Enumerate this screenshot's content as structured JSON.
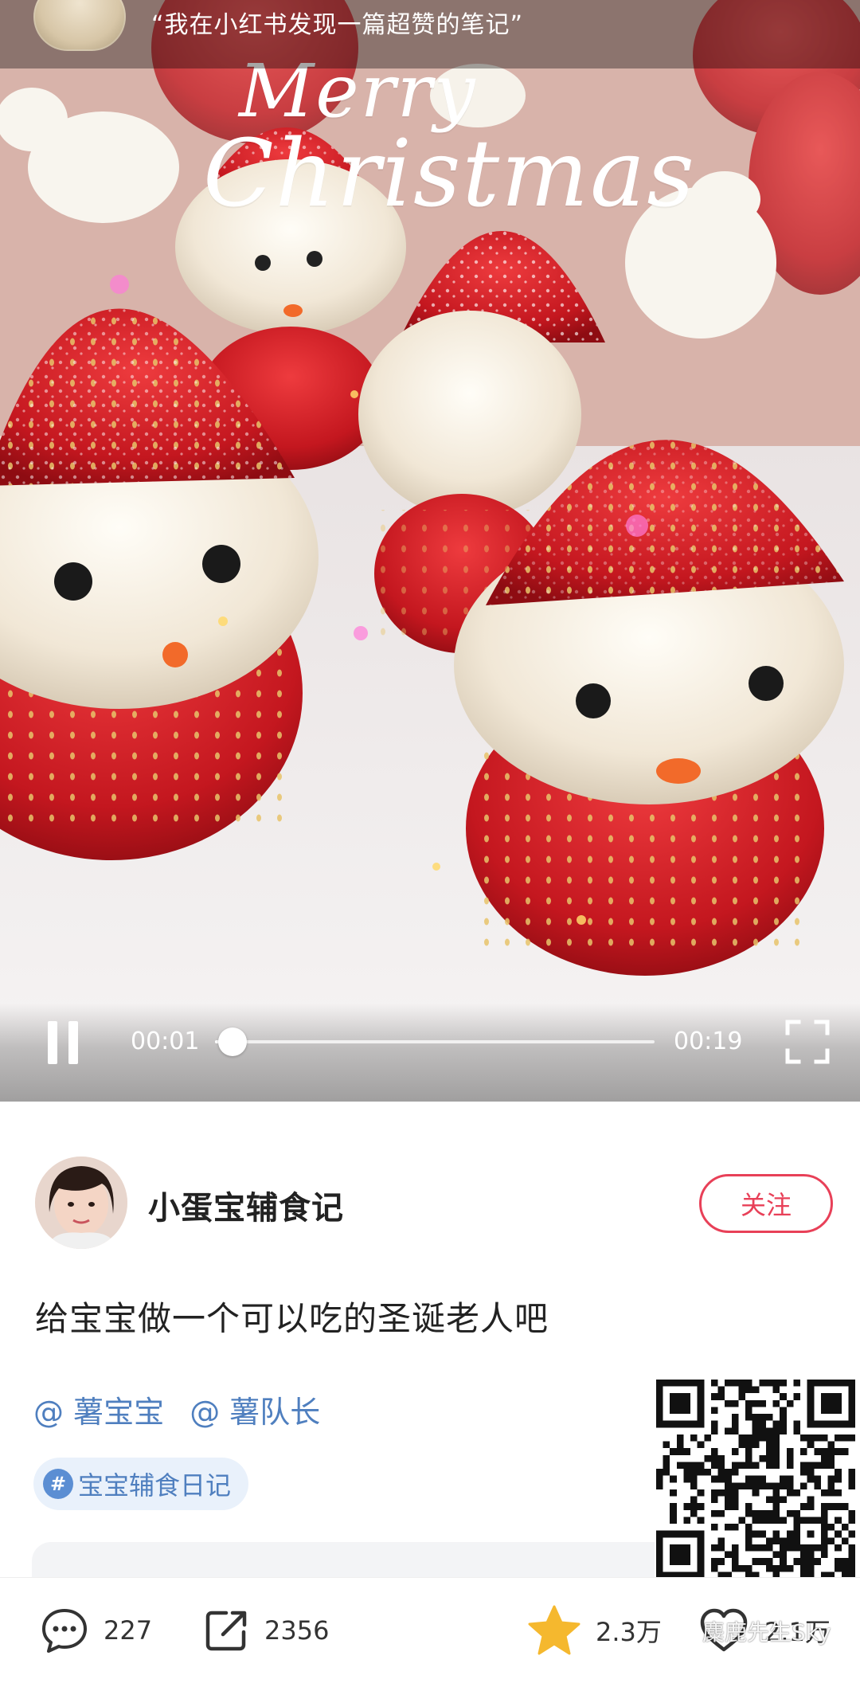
{
  "banner": {
    "text": "“我在小红书发现一篇超赞的笔记”"
  },
  "video": {
    "overlay_text_line1": "Merry",
    "overlay_text_line2": "Christmas",
    "current_time": "00:01",
    "total_time": "00:19",
    "progress_fraction": 0.04
  },
  "author": {
    "name": "小蛋宝辅食记",
    "follow_label": "关注"
  },
  "note": {
    "title": "给宝宝做一个可以吃的圣诞老人吧",
    "mentions": [
      "@ 薯宝宝",
      "@ 薯队长"
    ],
    "hashtag": "宝宝辅食日记",
    "hashtag_symbol": "#"
  },
  "bottom_bar": {
    "comments_count": "227",
    "shares_count": "2356",
    "stars_count": "2.3万",
    "likes_count": "2.1万"
  },
  "watermark": {
    "text": "麋鹿先生Sky"
  },
  "colors": {
    "accent_red": "#e84058",
    "link_blue": "#4f7fbf",
    "star_yellow": "#f5b82e"
  }
}
